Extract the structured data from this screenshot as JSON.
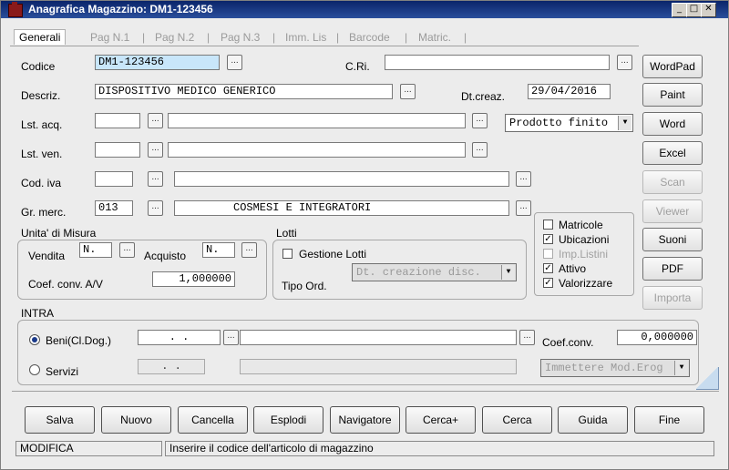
{
  "window": {
    "title": "Anagrafica Magazzino: DM1-123456"
  },
  "tabs": [
    "Generali",
    "Pag N.1",
    "Pag N.2",
    "Pag N.3",
    "Imm. Lis",
    "Barcode",
    "Matric."
  ],
  "fields": {
    "codice": {
      "label": "Codice",
      "value": "DM1-123456"
    },
    "cri": {
      "label": "C.Ri.",
      "value": ""
    },
    "descriz": {
      "label": "Descriz.",
      "value": "DISPOSITIVO MEDICO GENERICO"
    },
    "dtcreaz": {
      "label": "Dt.creaz.",
      "value": "29/04/2016"
    },
    "lst_acq": {
      "label": "Lst. acq.",
      "code": "",
      "desc": ""
    },
    "lst_ven": {
      "label": "Lst. ven.",
      "code": "",
      "desc": ""
    },
    "cod_iva": {
      "label": "Cod. iva",
      "code": "",
      "desc": ""
    },
    "gr_merc": {
      "label": "Gr. merc.",
      "code": "013",
      "desc": "COSMESI E INTEGRATORI"
    },
    "tipo_prodotto": {
      "value": "Prodotto finito"
    }
  },
  "dots_label": "...",
  "unita": {
    "title": "Unita' di Misura",
    "vendita_label": "Vendita",
    "vendita_value": "N.",
    "acquisto_label": "Acquisto",
    "acquisto_value": "N.",
    "coef_label": "Coef. conv. A/V",
    "coef_value": "1,000000"
  },
  "lotti": {
    "title": "Lotti",
    "gestione_label": "Gestione Lotti",
    "tipo_ord_label": "Tipo Ord.",
    "tipo_ord_value": "Dt. creazione disc."
  },
  "flags": [
    {
      "label": "Matricole",
      "checked": false,
      "disabled": false
    },
    {
      "label": "Ubicazioni",
      "checked": true,
      "disabled": false
    },
    {
      "label": "Imp.Listini",
      "checked": false,
      "disabled": true
    },
    {
      "label": "Attivo",
      "checked": true,
      "disabled": false
    },
    {
      "label": "Valorizzare",
      "checked": true,
      "disabled": false
    }
  ],
  "intra": {
    "title": "INTRA",
    "beni_label": "Beni(Cl.Dog.)",
    "beni_value": ".  .",
    "servizi_label": "Servizi",
    "servizi_value": ".  .",
    "coef_label": "Coef.conv.",
    "coef_value": "0,000000",
    "mod_erog_value": "Immettere Mod.Erog"
  },
  "side_buttons": [
    {
      "label": "WordPad",
      "disabled": false
    },
    {
      "label": "Paint",
      "disabled": false
    },
    {
      "label": "Word",
      "disabled": false
    },
    {
      "label": "Excel",
      "disabled": false
    },
    {
      "label": "Scan",
      "disabled": true
    },
    {
      "label": "Viewer",
      "disabled": true
    },
    {
      "label": "Suoni",
      "disabled": false
    },
    {
      "label": "PDF",
      "disabled": false
    },
    {
      "label": "Importa",
      "disabled": true
    }
  ],
  "bottom_buttons": [
    "Salva",
    "Nuovo",
    "Cancella",
    "Esplodi",
    "Navigatore",
    "Cerca+",
    "Cerca",
    "Guida",
    "Fine"
  ],
  "status": {
    "mode": "MODIFICA",
    "message": "Inserire il codice dell'articolo di magazzino"
  }
}
